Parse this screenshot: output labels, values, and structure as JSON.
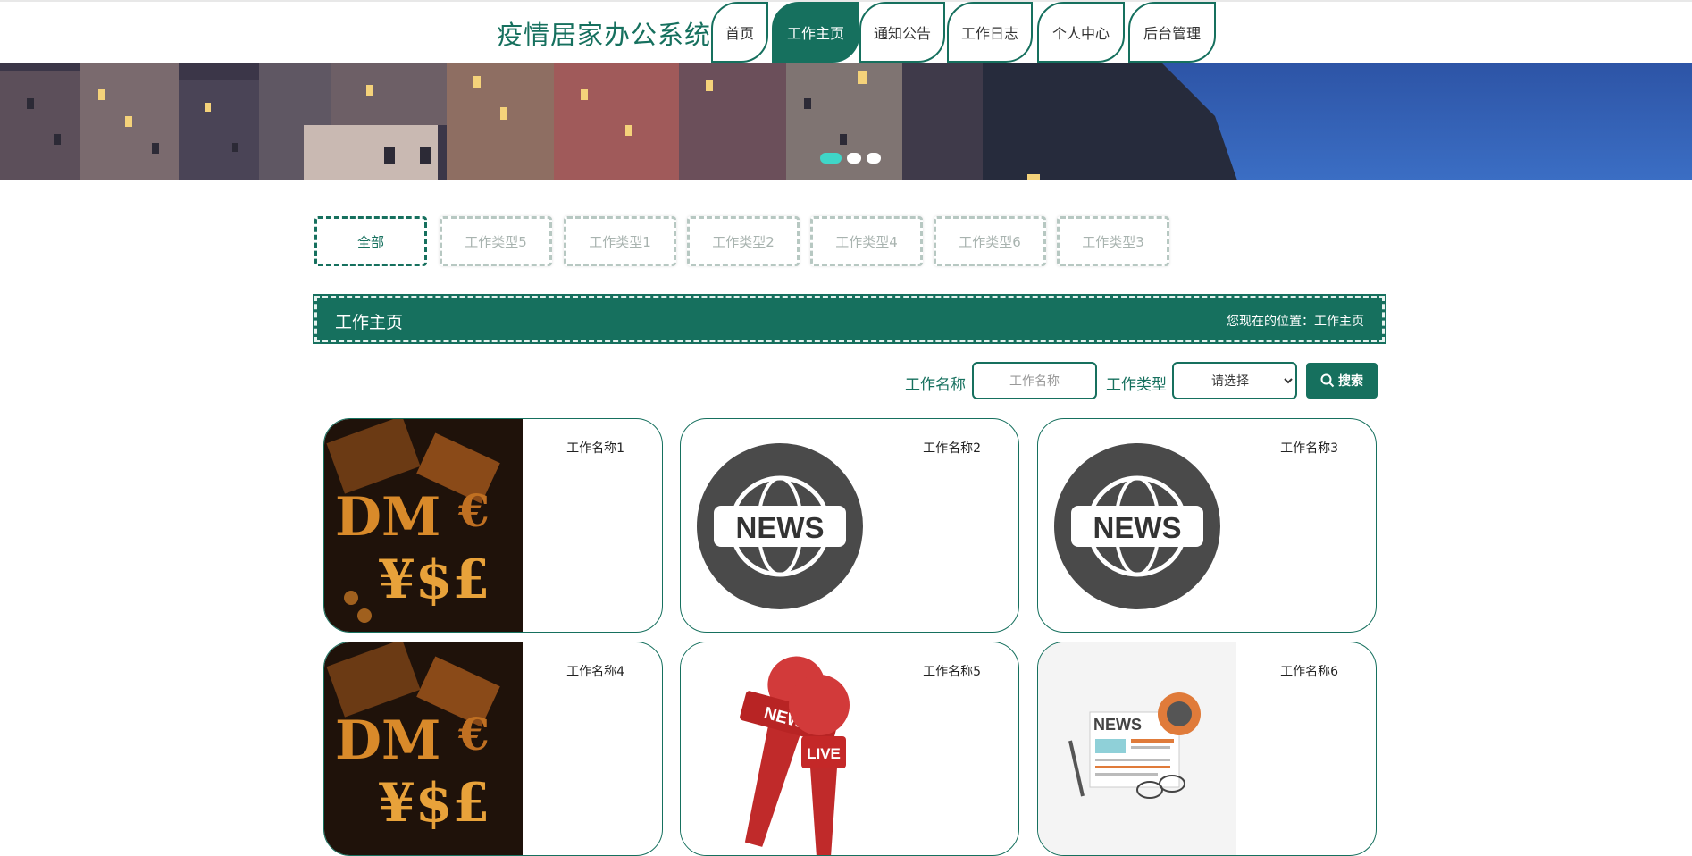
{
  "header": {
    "site_title": "疫情居家办公系统",
    "nav": [
      {
        "label": "首页"
      },
      {
        "label": "工作主页"
      },
      {
        "label": "通知公告"
      },
      {
        "label": "工作日志"
      },
      {
        "label": "个人中心"
      },
      {
        "label": "后台管理"
      }
    ],
    "active_nav_index": 1
  },
  "banner": {
    "slides": 3,
    "active_slide": 1
  },
  "categories": {
    "items": [
      "全部",
      "工作类型5",
      "工作类型1",
      "工作类型2",
      "工作类型4",
      "工作类型6",
      "工作类型3"
    ],
    "active_index": 0
  },
  "section": {
    "title": "工作主页",
    "breadcrumb": "您现在的位置：工作主页"
  },
  "search": {
    "name_label": "工作名称",
    "name_placeholder": "工作名称",
    "type_label": "工作类型",
    "type_selected": "请选择",
    "button_label": "搜索"
  },
  "cards": [
    {
      "title": "工作名称1",
      "image": "currency-symbols-image"
    },
    {
      "title": "工作名称2",
      "image": "news-globe-image"
    },
    {
      "title": "工作名称3",
      "image": "news-globe-image"
    },
    {
      "title": "工作名称4",
      "image": "currency-symbols-image"
    },
    {
      "title": "工作名称5",
      "image": "news-live-microphone-image"
    },
    {
      "title": "工作名称6",
      "image": "newspaper-coffee-image"
    }
  ],
  "colors": {
    "primary": "#16705e",
    "dot_active": "#3fd6c8",
    "category_inactive": "#b7c8c2"
  }
}
